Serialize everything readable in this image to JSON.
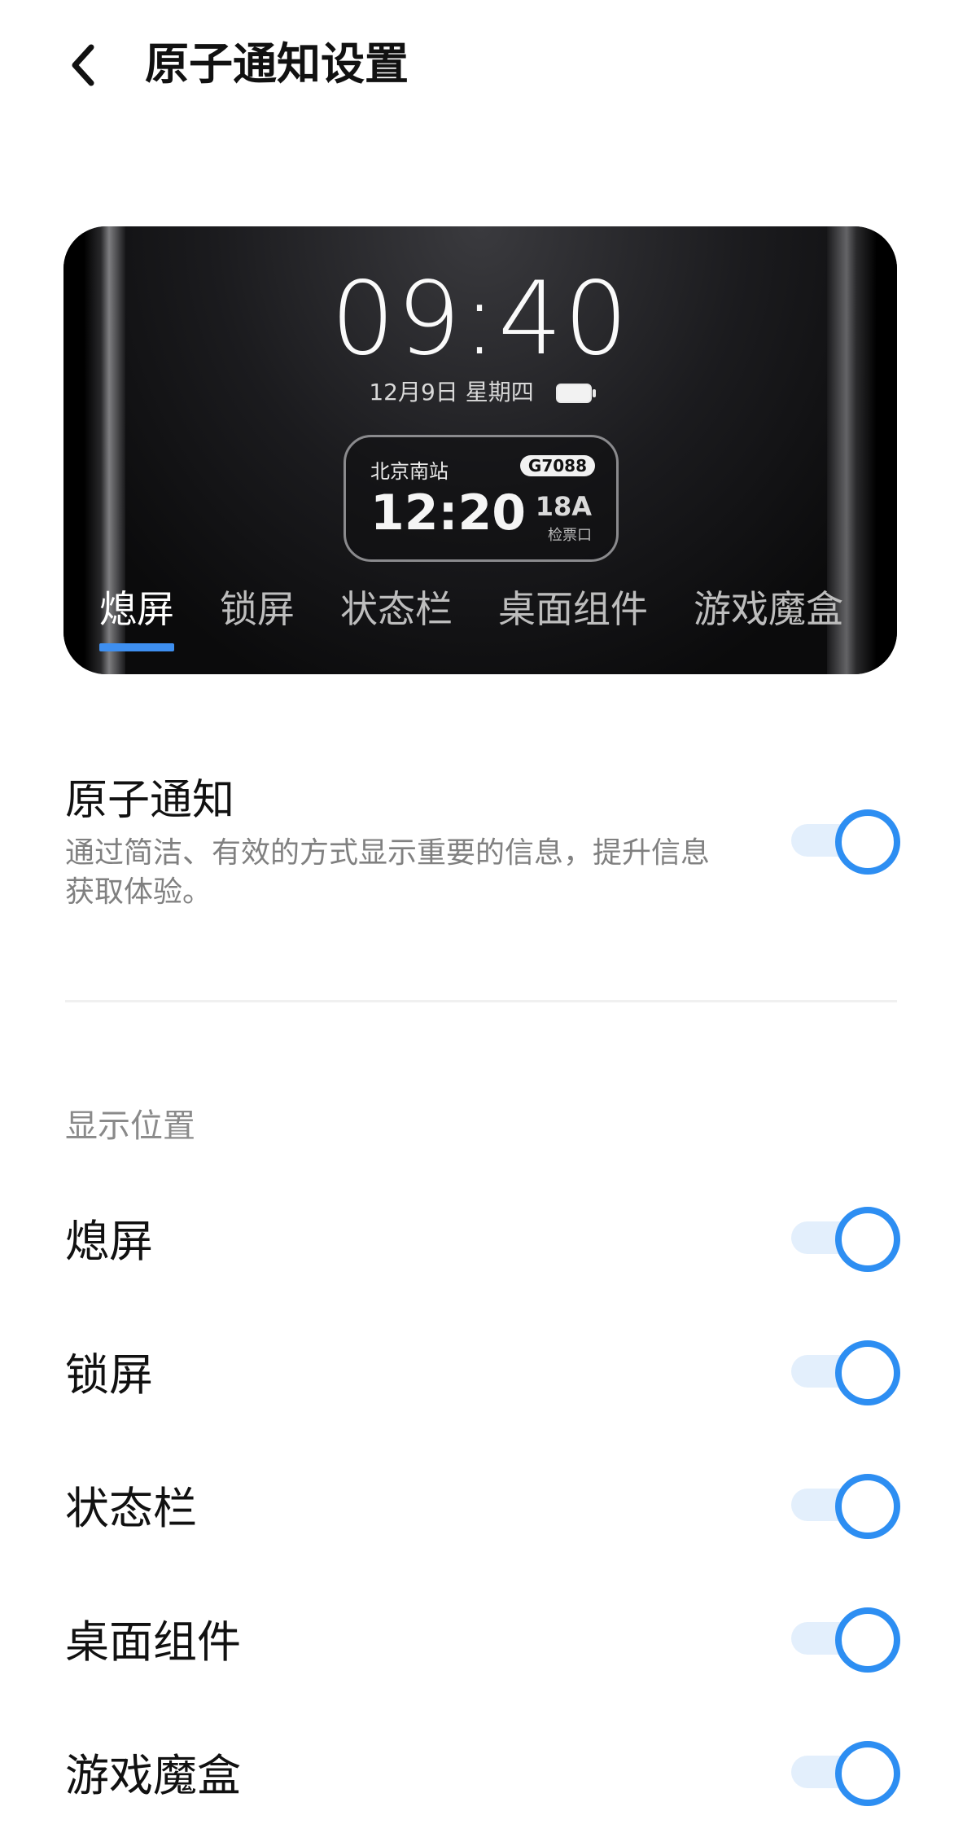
{
  "header": {
    "title": "原子通知设置"
  },
  "preview": {
    "clock": "09:40",
    "date": "12月9日 星期四",
    "ticket": {
      "station": "北京南站",
      "train": "G7088",
      "time": "12:20",
      "seat": "18A",
      "gate": "检票口"
    },
    "tabs": [
      "熄屏",
      "锁屏",
      "状态栏",
      "桌面组件",
      "游戏魔盒"
    ],
    "active_tab": "熄屏",
    "accent_color": "#3e8ff0"
  },
  "main_setting": {
    "title": "原子通知",
    "description": "通过简洁、有效的方式显示重要的信息，提升信息获取体验。",
    "enabled": true
  },
  "display_section": {
    "label": "显示位置",
    "items": [
      {
        "label": "熄屏",
        "enabled": true
      },
      {
        "label": "锁屏",
        "enabled": true
      },
      {
        "label": "状态栏",
        "enabled": true
      },
      {
        "label": "桌面组件",
        "enabled": true
      },
      {
        "label": "游戏魔盒",
        "enabled": true
      }
    ]
  },
  "colors": {
    "toggle_on": "#2d8ef2",
    "toggle_track": "#e3effc"
  }
}
